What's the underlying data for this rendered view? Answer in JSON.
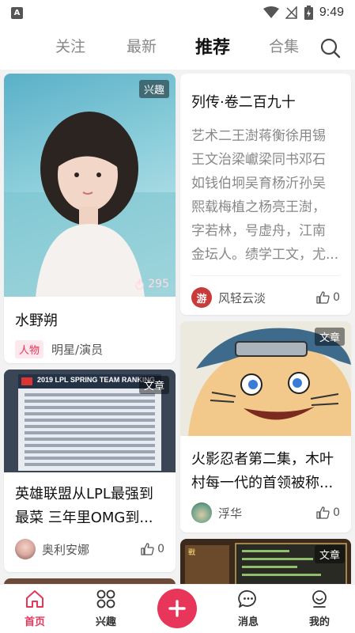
{
  "status_bar": {
    "time": "9:49",
    "app_icon": "A"
  },
  "top_tabs": [
    "关注",
    "最新",
    "推荐",
    "合集"
  ],
  "feed": {
    "card1": {
      "badge": "兴趣",
      "hot_count": "295",
      "title": "水野朔",
      "tag": "人物",
      "category": "明星/演员"
    },
    "card2": {
      "title": "列传·卷二百九十",
      "body_lines": [
        "艺术二王澍蒋衡徐用锡",
        "王文治梁巘梁同书邓石",
        "如钱伯坰吴育杨沂孙吴",
        "熙载梅植之杨亮王澍，",
        "字若林，号虚舟，江南",
        "金坛人。绩学工文，尤..."
      ],
      "author": "风轻云淡",
      "avatar_char": "游",
      "likes": "0"
    },
    "card3": {
      "badge": "文章",
      "thumb_title": "2019 LPL SPRING TEAM RANKING",
      "title_lines": [
        "英雄联盟从LPL最强到",
        "最菜 三年里OMG到..."
      ],
      "author": "奥利安娜",
      "likes": "0"
    },
    "card4": {
      "badge": "文章",
      "title_lines": [
        "火影忍者第二集，木叶",
        "村每一代的首领被称..."
      ],
      "author": "浮华",
      "likes": "0"
    },
    "card5": {
      "badge": "文章"
    }
  },
  "bottom_nav": {
    "home": "首页",
    "interest": "兴趣",
    "messages": "消息",
    "mine": "我的"
  },
  "colors": {
    "accent": "#e8355a"
  }
}
